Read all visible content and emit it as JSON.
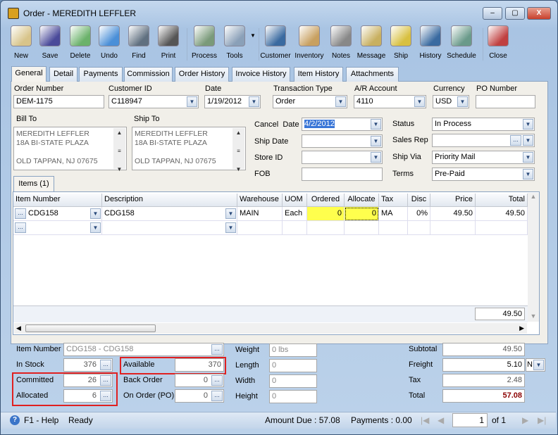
{
  "window": {
    "title": "Order - MEREDITH LEFFLER",
    "minimize": "–",
    "maximize": "▢",
    "close": "X"
  },
  "toolbar": [
    {
      "label": "New",
      "icon": "new-icon",
      "color": "#d8c48a"
    },
    {
      "label": "Save",
      "icon": "save-icon",
      "color": "#4a4a9a"
    },
    {
      "label": "Delete",
      "icon": "delete-icon",
      "color": "#6bb26b"
    },
    {
      "label": "Undo",
      "icon": "undo-icon",
      "color": "#4a8fd8"
    },
    {
      "label": "Find",
      "icon": "find-icon",
      "color": "#607080"
    },
    {
      "label": "Print",
      "icon": "print-icon",
      "color": "#555"
    },
    {
      "label": "Process",
      "icon": "process-icon",
      "color": "#7a9a7a"
    },
    {
      "label": "Tools",
      "icon": "tools-icon",
      "color": "#8aa0b8"
    },
    {
      "label": "Customer",
      "icon": "customer-icon",
      "color": "#3a6aa0"
    },
    {
      "label": "Inventory",
      "icon": "inventory-icon",
      "color": "#c8a060"
    },
    {
      "label": "Notes",
      "icon": "notes-icon",
      "color": "#888"
    },
    {
      "label": "Message",
      "icon": "message-icon",
      "color": "#c8b060"
    },
    {
      "label": "Ship",
      "icon": "ship-icon",
      "color": "#d8c040"
    },
    {
      "label": "History",
      "icon": "history-icon",
      "color": "#3a6aa0"
    },
    {
      "label": "Schedule",
      "icon": "schedule-icon",
      "color": "#6a9a8a"
    },
    {
      "label": "Close",
      "icon": "close-icon",
      "color": "#c04040"
    }
  ],
  "tabs": [
    "General",
    "Detail",
    "Payments",
    "Commission",
    "Order History",
    "Invoice History",
    "Item History",
    "Attachments"
  ],
  "header": {
    "order_number": {
      "label": "Order Number",
      "value": "DEM-1175"
    },
    "customer_id": {
      "label": "Customer ID",
      "value": "C118947"
    },
    "date": {
      "label": "Date",
      "value": "1/19/2012"
    },
    "transaction_type": {
      "label": "Transaction Type",
      "value": "Order"
    },
    "ar_account": {
      "label": "A/R Account",
      "value": "4110"
    },
    "currency": {
      "label": "Currency",
      "value": "USD"
    },
    "po_number": {
      "label": "PO Number",
      "value": ""
    }
  },
  "bill_to": {
    "label": "Bill To",
    "line1": "MEREDITH LEFFLER",
    "line2": "18A BI-STATE PLAZA",
    "line3": "OLD TAPPAN, NJ 07675"
  },
  "ship_to": {
    "label": "Ship To",
    "line1": "MEREDITH LEFFLER",
    "line2": "18A BI-STATE PLAZA",
    "line3": "OLD TAPPAN, NJ 07675"
  },
  "mid": {
    "cancel_date": {
      "label": "Cancel  Date",
      "value": "4/2/2012"
    },
    "ship_date": {
      "label": "Ship Date",
      "value": ""
    },
    "store_id": {
      "label": "Store ID",
      "value": ""
    },
    "fob": {
      "label": "FOB",
      "value": ""
    }
  },
  "right": {
    "status": {
      "label": "Status",
      "value": "In Process"
    },
    "sales_rep": {
      "label": "Sales Rep",
      "value": ""
    },
    "ship_via": {
      "label": "Ship Via",
      "value": "Priority Mail"
    },
    "terms": {
      "label": "Terms",
      "value": "Pre-Paid"
    }
  },
  "items_tab": "Items (1)",
  "grid": {
    "columns": [
      "Item Number",
      "Description",
      "Warehouse",
      "UOM",
      "Ordered",
      "Allocate",
      "Tax",
      "Disc",
      "Price",
      "Total"
    ],
    "rows": [
      {
        "item": "CDG158",
        "description": "CDG158",
        "warehouse": "MAIN",
        "uom": "Each",
        "ordered": "0",
        "allocate": "0",
        "tax": "MA",
        "disc": "0%",
        "price": "49.50",
        "total": "49.50"
      }
    ],
    "footer_total": "49.50"
  },
  "bottom": {
    "item_number": {
      "label": "Item Number",
      "value": "CDG158 - CDG158"
    },
    "in_stock": {
      "label": "In Stock",
      "value": "376"
    },
    "committed": {
      "label": "Committed",
      "value": "26"
    },
    "allocated": {
      "label": "Allocated",
      "value": "6"
    },
    "available": {
      "label": "Available",
      "value": "370"
    },
    "back_order": {
      "label": "Back Order",
      "value": "0"
    },
    "on_order": {
      "label": "On Order (PO)",
      "value": "0"
    },
    "weight": {
      "label": "Weight",
      "value": "0 lbs"
    },
    "length": {
      "label": "Length",
      "value": "0"
    },
    "width": {
      "label": "Width",
      "value": "0"
    },
    "height": {
      "label": "Height",
      "value": "0"
    },
    "subtotal": {
      "label": "Subtotal",
      "value": "49.50"
    },
    "freight": {
      "label": "Freight",
      "value": "5.10",
      "option": "N"
    },
    "tax": {
      "label": "Tax",
      "value": "2.48"
    },
    "total": {
      "label": "Total",
      "value": "57.08"
    }
  },
  "status": {
    "help": "F1 - Help",
    "state": "Ready",
    "amount_due": "Amount Due : 57.08",
    "payments": "Payments : 0.00",
    "page": "1",
    "of": "of 1"
  },
  "colors": {
    "highlight": "#ffff4d",
    "callout": "#e02020",
    "total": "#8b0000"
  }
}
